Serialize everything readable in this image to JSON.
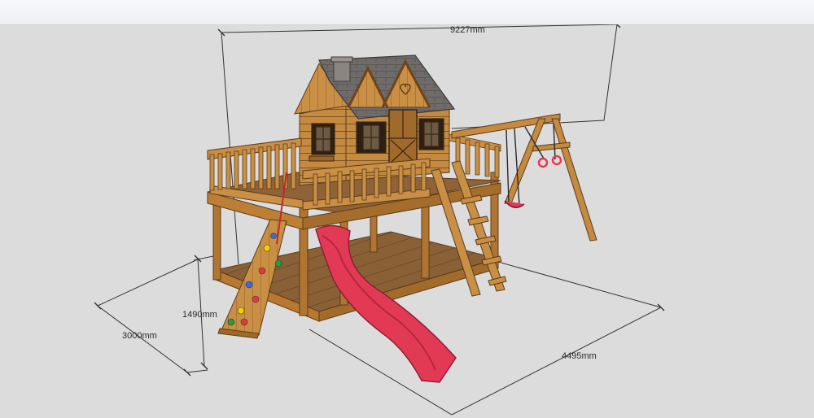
{
  "dimensions": {
    "width_label": "9227mm",
    "depth_label": "3000mm",
    "height_label": "1490mm",
    "length_label": "4495mm"
  },
  "colors": {
    "background": "#dcdcdc",
    "wood": "#c98f45",
    "wood_dark": "#7a4f22",
    "roof": "#6f6b6a",
    "slide": "#e23a55",
    "floor": "#8a6136"
  }
}
